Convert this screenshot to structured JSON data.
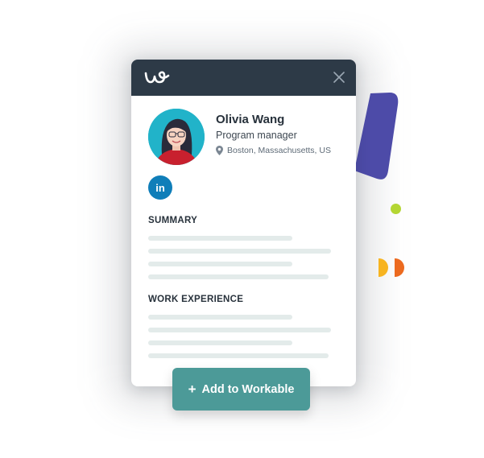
{
  "colors": {
    "header_bg": "#2d3a47",
    "button_teal": "#4c9a98",
    "linkedin_blue": "#0f7eb9",
    "avatar_bg": "#21b3c9",
    "deco_purple": "#4d4ba8",
    "deco_green": "#b4d633",
    "deco_yellow": "#f7b421",
    "deco_orange": "#ec6a1f"
  },
  "header": {
    "logo_icon": "workable-w-logo",
    "close_icon": "close-x-icon"
  },
  "profile": {
    "name": "Olivia Wang",
    "title": "Program manager",
    "location": "Boston, Massachusetts, US",
    "location_icon": "map-pin-icon"
  },
  "social": {
    "linkedin_label": "in"
  },
  "sections": {
    "summary": "SUMMARY",
    "experience": "WORK EXPERIENCE"
  },
  "action": {
    "plus": "+",
    "label": "Add to Workable"
  }
}
